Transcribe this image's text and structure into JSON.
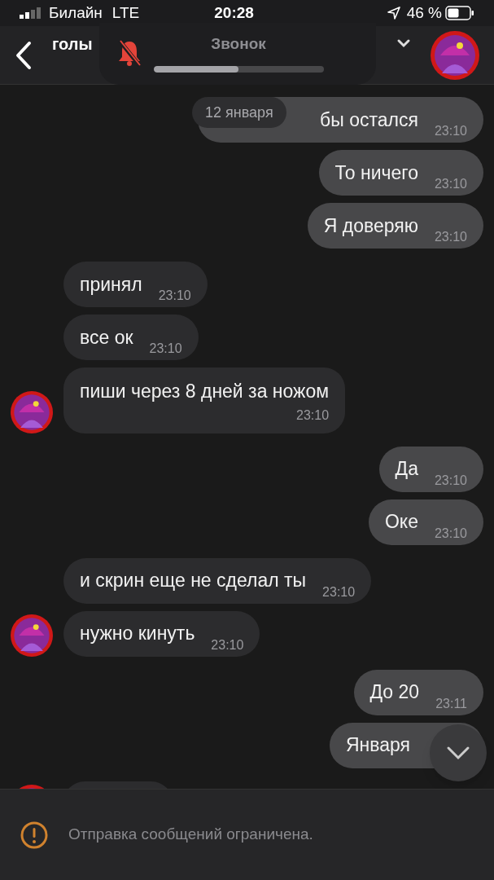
{
  "status_bar": {
    "carrier": "Билайн",
    "network": "LTE",
    "time": "20:28",
    "battery": "46 %"
  },
  "header": {
    "title": "голы",
    "call": {
      "label": "Звонок",
      "muted": true,
      "level": 0.5
    }
  },
  "date_label": "12 января",
  "messages": [
    {
      "outgoing": true,
      "kind": "date_covered",
      "text": "бы остался",
      "time": "23:10"
    },
    {
      "outgoing": true,
      "kind": "inline",
      "text": "То ничего",
      "time": "23:10"
    },
    {
      "outgoing": true,
      "kind": "inline",
      "text": "Я доверяю",
      "time": "23:10"
    },
    {
      "outgoing": false,
      "avatar": false,
      "kind": "inline",
      "text": "принял",
      "time": "23:10"
    },
    {
      "outgoing": false,
      "avatar": false,
      "kind": "inline",
      "text": "все ок",
      "time": "23:10"
    },
    {
      "outgoing": false,
      "avatar": true,
      "kind": "wrapped",
      "text": "пиши через 8 дней за ножом",
      "time": "23:10"
    },
    {
      "outgoing": true,
      "kind": "inline",
      "text": "Да",
      "time": "23:10"
    },
    {
      "outgoing": true,
      "kind": "inline",
      "text": "Оке",
      "time": "23:10"
    },
    {
      "outgoing": false,
      "avatar": false,
      "kind": "inline",
      "text": "и скрин еще не сделал ты",
      "time": "23:10"
    },
    {
      "outgoing": false,
      "avatar": true,
      "kind": "inline",
      "text": "нужно кинуть",
      "time": "23:10"
    },
    {
      "outgoing": true,
      "kind": "inline",
      "text": "До 20",
      "time": "23:11"
    },
    {
      "outgoing": true,
      "kind": "covered",
      "text": "Января"
    },
    {
      "outgoing": false,
      "avatar": true,
      "kind": "cut"
    }
  ],
  "footer": {
    "notice": "Отправка сообщений ограничена."
  }
}
